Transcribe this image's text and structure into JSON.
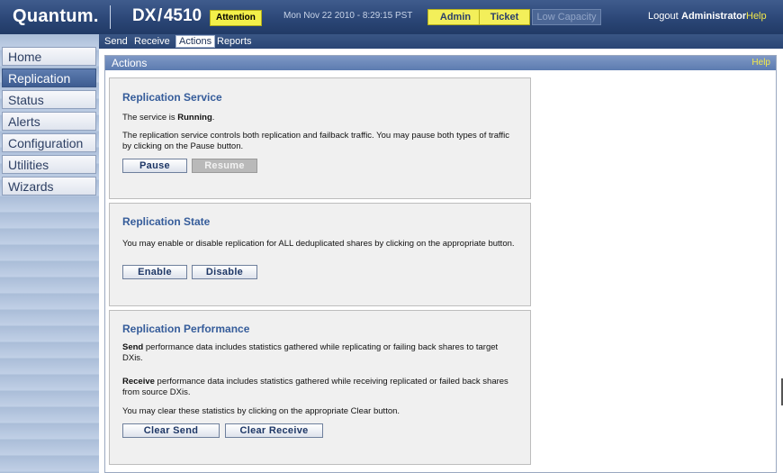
{
  "header": {
    "brand": "Quantum.",
    "model": "DX / 4510",
    "attention": "Attention",
    "datetime": "Mon Nov 22 2010 - 8:29:15 PST",
    "admin": "Admin",
    "ticket": "Ticket",
    "low_capacity": "Low Capacity",
    "logout": "Logout",
    "user": "Administrator",
    "help": "Help"
  },
  "sidebar": {
    "items": [
      {
        "label": "Home"
      },
      {
        "label": "Replication"
      },
      {
        "label": "Status"
      },
      {
        "label": "Alerts"
      },
      {
        "label": "Configuration"
      },
      {
        "label": "Utilities"
      },
      {
        "label": "Wizards"
      }
    ],
    "active": "Replication"
  },
  "tabs": [
    {
      "label": "Send"
    },
    {
      "label": "Receive"
    },
    {
      "label": "Actions"
    },
    {
      "label": "Reports"
    }
  ],
  "content": {
    "title": "Actions",
    "help": "Help",
    "service": {
      "title": "Replication Service",
      "status_prefix": "The service is ",
      "status_value": "Running",
      "status_suffix": ".",
      "description": "The replication service controls both replication and failback traffic. You may pause both types of traffic by clicking on the Pause button.",
      "pause": "Pause",
      "resume": "Resume"
    },
    "state": {
      "title": "Replication State",
      "description": "You may enable or disable replication for ALL deduplicated shares by clicking on the appropriate button.",
      "enable": "Enable",
      "disable": "Disable"
    },
    "performance": {
      "title": "Replication Performance",
      "send_term": "Send",
      "send_text": " performance data includes statistics gathered while replicating or failing back shares to target DXis.",
      "receive_term": "Receive",
      "receive_text": " performance data includes statistics gathered while receiving replicated or failed back shares from source DXis.",
      "clear_text": "You may clear these statistics by clicking on the appropriate Clear button.",
      "clear_send": "Clear Send",
      "clear_receive": "Clear Receive"
    }
  }
}
